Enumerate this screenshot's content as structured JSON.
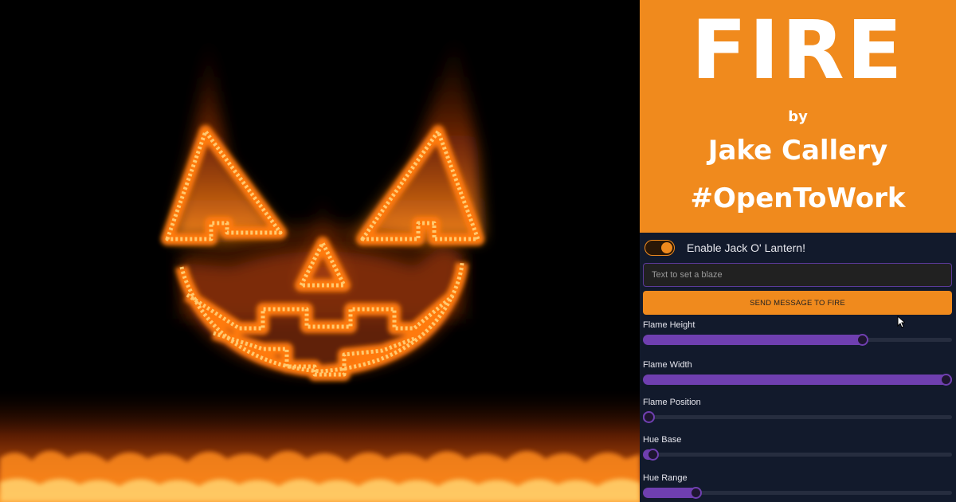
{
  "banner": {
    "title": "FIRE",
    "by": "by",
    "author": "Jake Callery",
    "tag": "#OpenToWork"
  },
  "controls": {
    "jack_toggle": {
      "label": "Enable Jack O' Lantern!",
      "on": true
    },
    "message_input": {
      "placeholder": "Text to set a blaze",
      "value": ""
    },
    "send_button": "SEND MESSAGE TO FIRE",
    "sliders": [
      {
        "label": "Flame Height",
        "fraction": 0.72
      },
      {
        "label": "Flame Width",
        "fraction": 1.0
      },
      {
        "label": "Flame Position",
        "fraction": 0.0
      },
      {
        "label": "Hue Base",
        "fraction": 0.04
      },
      {
        "label": "Hue Range",
        "fraction": 0.18
      }
    ]
  },
  "icons": {
    "toggle": "toggle-switch-on",
    "pointer": "mouse-pointer-icon"
  },
  "colors": {
    "accent_orange": "#f08a1d",
    "slider_purple": "#6f3fb0",
    "panel_bg": "#121a2c"
  }
}
